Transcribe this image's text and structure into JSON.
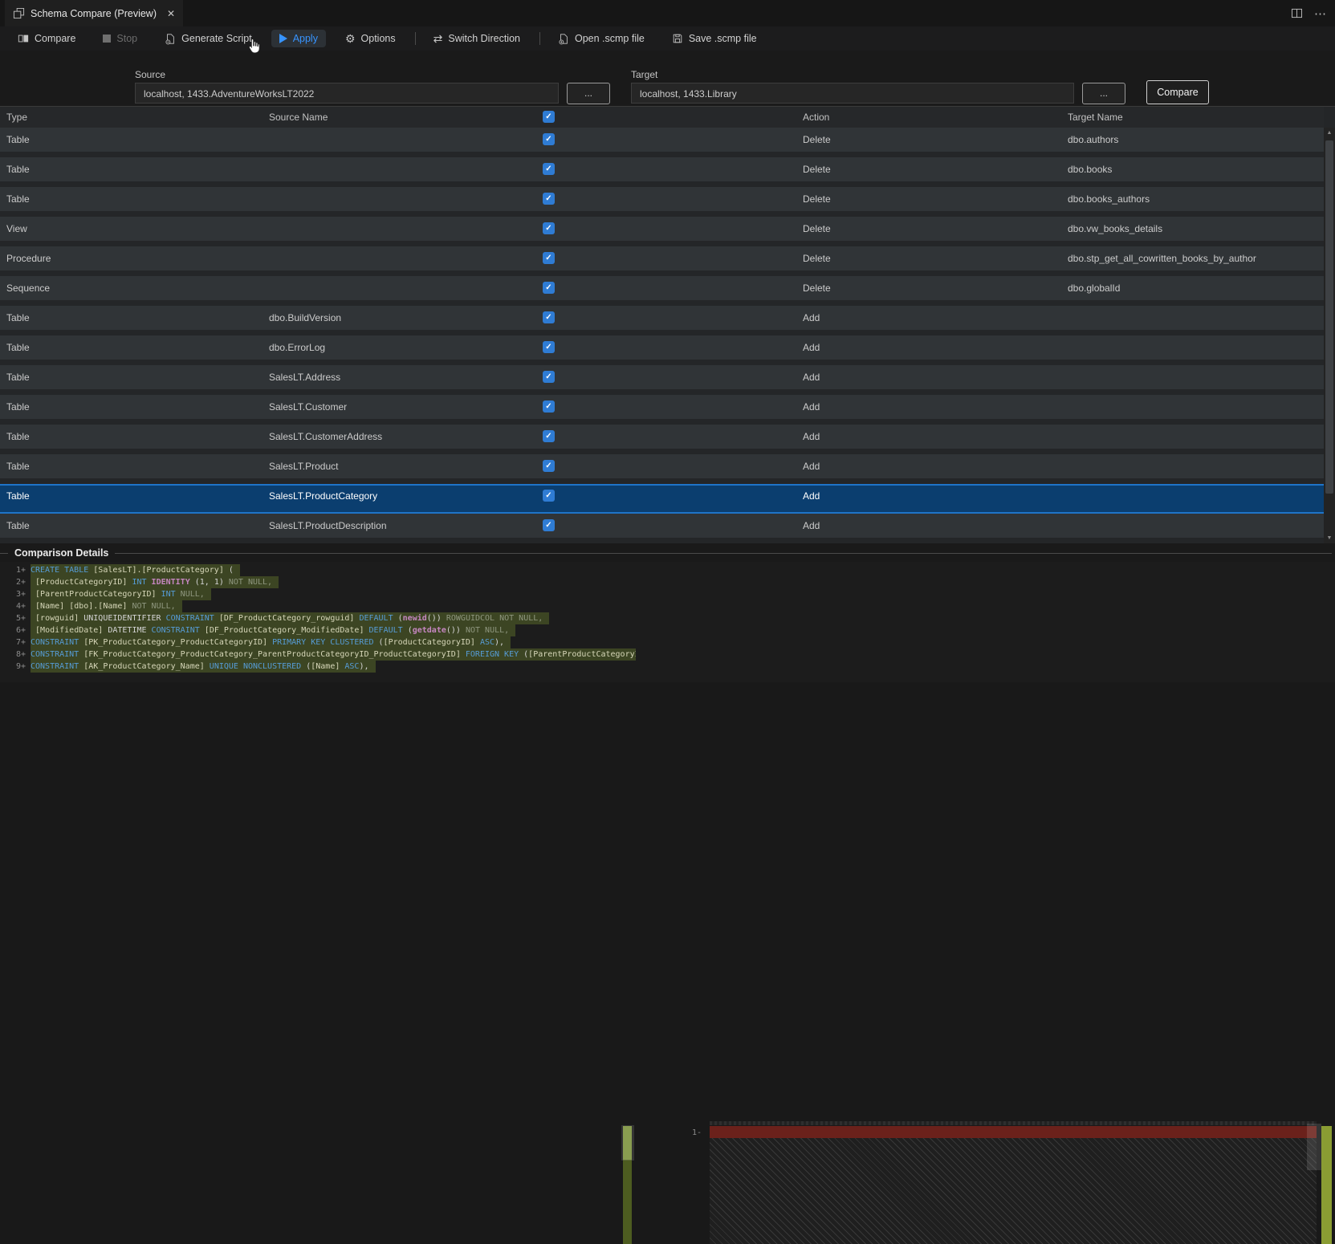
{
  "colors": {
    "accent": "#3794ff",
    "checkbox": "#2f7cd4",
    "selection": "#0b3e6f",
    "add-bg": "#3c4523",
    "del-bar": "#6b211b"
  },
  "icons": {
    "close": "✕",
    "ellipsis": "⋯",
    "gear": "⚙",
    "switch": "⇄",
    "up": "▲",
    "down": "▼",
    "check": "✓"
  },
  "tab": {
    "title": "Schema Compare (Preview)"
  },
  "toolbar": {
    "compare": "Compare",
    "stop": "Stop",
    "generate_script": "Generate Script",
    "apply": "Apply",
    "options": "Options",
    "switch_direction": "Switch Direction",
    "open_scmp": "Open .scmp file",
    "save_scmp": "Save .scmp file"
  },
  "connection": {
    "source_label": "Source",
    "source_value": "localhost, 1433.AdventureWorksLT2022",
    "target_label": "Target",
    "target_value": "localhost, 1433.Library",
    "browse_label": "...",
    "compare_label": "Compare"
  },
  "grid": {
    "columns": {
      "type": "Type",
      "source": "Source Name",
      "action": "Action",
      "target": "Target Name"
    },
    "rows": [
      {
        "type": "Table",
        "source": "",
        "action": "Delete",
        "target": "dbo.authors",
        "checked": true,
        "selected": false
      },
      {
        "type": "Table",
        "source": "",
        "action": "Delete",
        "target": "dbo.books",
        "checked": true,
        "selected": false
      },
      {
        "type": "Table",
        "source": "",
        "action": "Delete",
        "target": "dbo.books_authors",
        "checked": true,
        "selected": false
      },
      {
        "type": "View",
        "source": "",
        "action": "Delete",
        "target": "dbo.vw_books_details",
        "checked": true,
        "selected": false
      },
      {
        "type": "Procedure",
        "source": "",
        "action": "Delete",
        "target": "dbo.stp_get_all_cowritten_books_by_author",
        "checked": true,
        "selected": false
      },
      {
        "type": "Sequence",
        "source": "",
        "action": "Delete",
        "target": "dbo.globalId",
        "checked": true,
        "selected": false
      },
      {
        "type": "Table",
        "source": "dbo.BuildVersion",
        "action": "Add",
        "target": "",
        "checked": true,
        "selected": false
      },
      {
        "type": "Table",
        "source": "dbo.ErrorLog",
        "action": "Add",
        "target": "",
        "checked": true,
        "selected": false
      },
      {
        "type": "Table",
        "source": "SalesLT.Address",
        "action": "Add",
        "target": "",
        "checked": true,
        "selected": false
      },
      {
        "type": "Table",
        "source": "SalesLT.Customer",
        "action": "Add",
        "target": "",
        "checked": true,
        "selected": false
      },
      {
        "type": "Table",
        "source": "SalesLT.CustomerAddress",
        "action": "Add",
        "target": "",
        "checked": true,
        "selected": false
      },
      {
        "type": "Table",
        "source": "SalesLT.Product",
        "action": "Add",
        "target": "",
        "checked": true,
        "selected": false
      },
      {
        "type": "Table",
        "source": "SalesLT.ProductCategory",
        "action": "Add",
        "target": "",
        "checked": true,
        "selected": true
      },
      {
        "type": "Table",
        "source": "SalesLT.ProductDescription",
        "action": "Add",
        "target": "",
        "checked": true,
        "selected": false
      }
    ]
  },
  "details": {
    "title": "Comparison Details",
    "right_label": "1-",
    "left_lines": [
      {
        "n": "1",
        "s": "+",
        "t": [
          [
            "kw",
            "CREATE TABLE"
          ],
          [
            "pl",
            " "
          ],
          [
            "id",
            "[SalesLT].[ProductCategory]"
          ],
          [
            "pl",
            " ("
          ]
        ]
      },
      {
        "n": "2",
        "s": "+",
        "t": [
          [
            "pl",
            " "
          ],
          [
            "id",
            "[ProductCategoryID]"
          ],
          [
            "pl",
            " "
          ],
          [
            "kw",
            "INT"
          ],
          [
            "pl",
            " "
          ],
          [
            "fn",
            "IDENTITY"
          ],
          [
            "pl",
            " (1, 1) "
          ],
          [
            "dim",
            "NOT NULL,"
          ]
        ]
      },
      {
        "n": "3",
        "s": "+",
        "t": [
          [
            "pl",
            " "
          ],
          [
            "id",
            "[ParentProductCategoryID]"
          ],
          [
            "pl",
            " "
          ],
          [
            "kw",
            "INT"
          ],
          [
            "pl",
            " "
          ],
          [
            "dim",
            "NULL,"
          ]
        ]
      },
      {
        "n": "4",
        "s": "+",
        "t": [
          [
            "pl",
            " "
          ],
          [
            "id",
            "[Name]"
          ],
          [
            "pl",
            " "
          ],
          [
            "id",
            "[dbo].[Name]"
          ],
          [
            "pl",
            " "
          ],
          [
            "dim",
            "NOT NULL,"
          ]
        ]
      },
      {
        "n": "5",
        "s": "+",
        "t": [
          [
            "pl",
            " "
          ],
          [
            "id",
            "[rowguid]"
          ],
          [
            "pl",
            " UNIQUEIDENTIFIER "
          ],
          [
            "kw",
            "CONSTRAINT"
          ],
          [
            "pl",
            " "
          ],
          [
            "id",
            "[DF_ProductCategory_rowguid]"
          ],
          [
            "pl",
            " "
          ],
          [
            "kw",
            "DEFAULT"
          ],
          [
            "pl",
            " ("
          ],
          [
            "fn",
            "newid"
          ],
          [
            "pl",
            "()) "
          ],
          [
            "dim",
            "ROWGUIDCOL NOT NULL,"
          ]
        ]
      },
      {
        "n": "6",
        "s": "+",
        "t": [
          [
            "pl",
            " "
          ],
          [
            "id",
            "[ModifiedDate]"
          ],
          [
            "pl",
            " DATETIME "
          ],
          [
            "kw",
            "CONSTRAINT"
          ],
          [
            "pl",
            " "
          ],
          [
            "id",
            "[DF_ProductCategory_ModifiedDate]"
          ],
          [
            "pl",
            " "
          ],
          [
            "kw",
            "DEFAULT"
          ],
          [
            "pl",
            " ("
          ],
          [
            "fn",
            "getdate"
          ],
          [
            "pl",
            "()) "
          ],
          [
            "dim",
            "NOT NULL,"
          ]
        ]
      },
      {
        "n": "7",
        "s": "+",
        "t": [
          [
            "kw",
            "CONSTRAINT"
          ],
          [
            "pl",
            " "
          ],
          [
            "id",
            "[PK_ProductCategory_ProductCategoryID]"
          ],
          [
            "pl",
            " "
          ],
          [
            "kw",
            "PRIMARY KEY CLUSTERED"
          ],
          [
            "pl",
            " ("
          ],
          [
            "id",
            "[ProductCategoryID]"
          ],
          [
            "pl",
            " "
          ],
          [
            "kw",
            "ASC"
          ],
          [
            "pl",
            "),"
          ]
        ]
      },
      {
        "n": "8",
        "s": "+",
        "t": [
          [
            "kw",
            "CONSTRAINT"
          ],
          [
            "pl",
            " "
          ],
          [
            "id",
            "[FK_ProductCategory_ProductCategory_ParentProductCategoryID_ProductCategoryID]"
          ],
          [
            "pl",
            " "
          ],
          [
            "kw",
            "FOREIGN KEY"
          ],
          [
            "pl",
            " ("
          ],
          [
            "id",
            "[ParentProductCategoryID] REFERENCES"
          ]
        ]
      },
      {
        "n": "9",
        "s": "+",
        "t": [
          [
            "kw",
            "CONSTRAINT"
          ],
          [
            "pl",
            " "
          ],
          [
            "id",
            "[AK_ProductCategory_Name]"
          ],
          [
            "pl",
            " "
          ],
          [
            "kw",
            "UNIQUE NONCLUSTERED"
          ],
          [
            "pl",
            " ("
          ],
          [
            "id",
            "[Name]"
          ],
          [
            "pl",
            " "
          ],
          [
            "kw",
            "ASC"
          ],
          [
            "pl",
            "),"
          ]
        ]
      }
    ]
  }
}
